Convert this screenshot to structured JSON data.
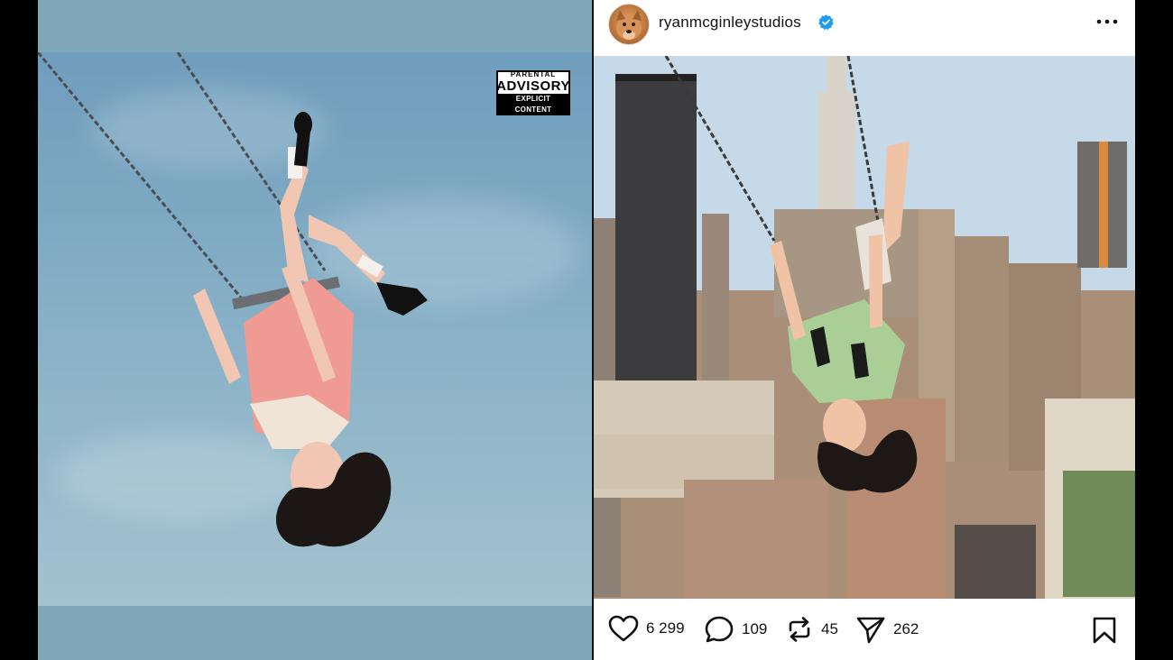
{
  "cover": {
    "advisory_top": "PARENTAL",
    "advisory_mid": "ADVISORY",
    "advisory_bottom": "EXPLICIT CONTENT"
  },
  "post": {
    "username": "ryanmcginleystudios",
    "verified": true,
    "actions": {
      "likes": "6 299",
      "comments": "109",
      "reposts": "45",
      "shares": "262"
    }
  },
  "colors": {
    "sky_blue": "#7fa6b9",
    "verified_blue": "#1d9bf0",
    "text": "#111111"
  },
  "icons": {
    "like": "heart-icon",
    "comment": "comment-icon",
    "repost": "repost-icon",
    "share": "send-icon",
    "save": "bookmark-icon",
    "more": "more-icon",
    "verified": "verified-badge-icon"
  }
}
